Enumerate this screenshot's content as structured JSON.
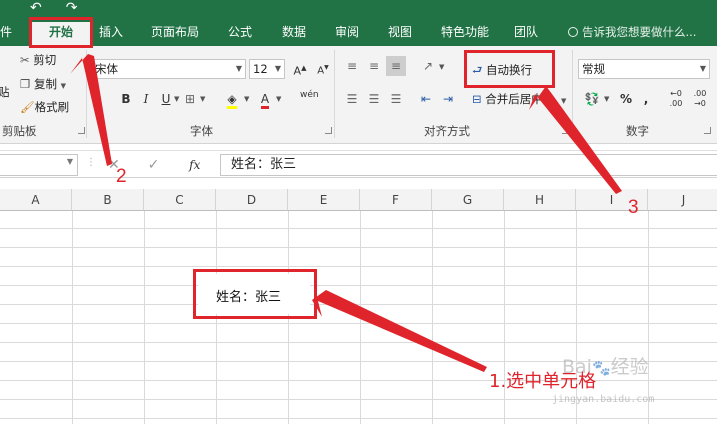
{
  "tabs": [
    {
      "label": "件",
      "active": false
    },
    {
      "label": "开始",
      "active": true
    },
    {
      "label": "插入",
      "active": false
    },
    {
      "label": "页面布局",
      "active": false
    },
    {
      "label": "公式",
      "active": false
    },
    {
      "label": "数据",
      "active": false
    },
    {
      "label": "审阅",
      "active": false
    },
    {
      "label": "视图",
      "active": false
    },
    {
      "label": "特色功能",
      "active": false
    },
    {
      "label": "团队",
      "active": false
    }
  ],
  "tell_me": "告诉我您想要做什么...",
  "ribbon": {
    "clipboard": {
      "paste": "贴",
      "cut": "剪切",
      "copy": "复制",
      "format_painter": "格式刷",
      "group_label": "剪贴板"
    },
    "font": {
      "font_name": "宋体",
      "font_size": "12",
      "bold": "B",
      "italic": "I",
      "underline": "U",
      "phonetic": "wén",
      "group_label": "字体"
    },
    "alignment": {
      "wrap_text": "自动换行",
      "merge_center": "合并后居中",
      "group_label": "对齐方式"
    },
    "number": {
      "format": "常规",
      "percent": "%",
      "comma": ",",
      "group_label": "数字"
    }
  },
  "formula_bar": {
    "fx": "fx",
    "content": "姓名：张三"
  },
  "columns": [
    "A",
    "B",
    "C",
    "D",
    "E",
    "F",
    "G",
    "H",
    "I",
    "J"
  ],
  "cell_value": "姓名：张三",
  "annotations": {
    "step1": "1.选中单元格",
    "step2": "2",
    "step3": "3"
  },
  "colors": {
    "excel_green": "#217346",
    "annotation_red": "#e0242b"
  }
}
